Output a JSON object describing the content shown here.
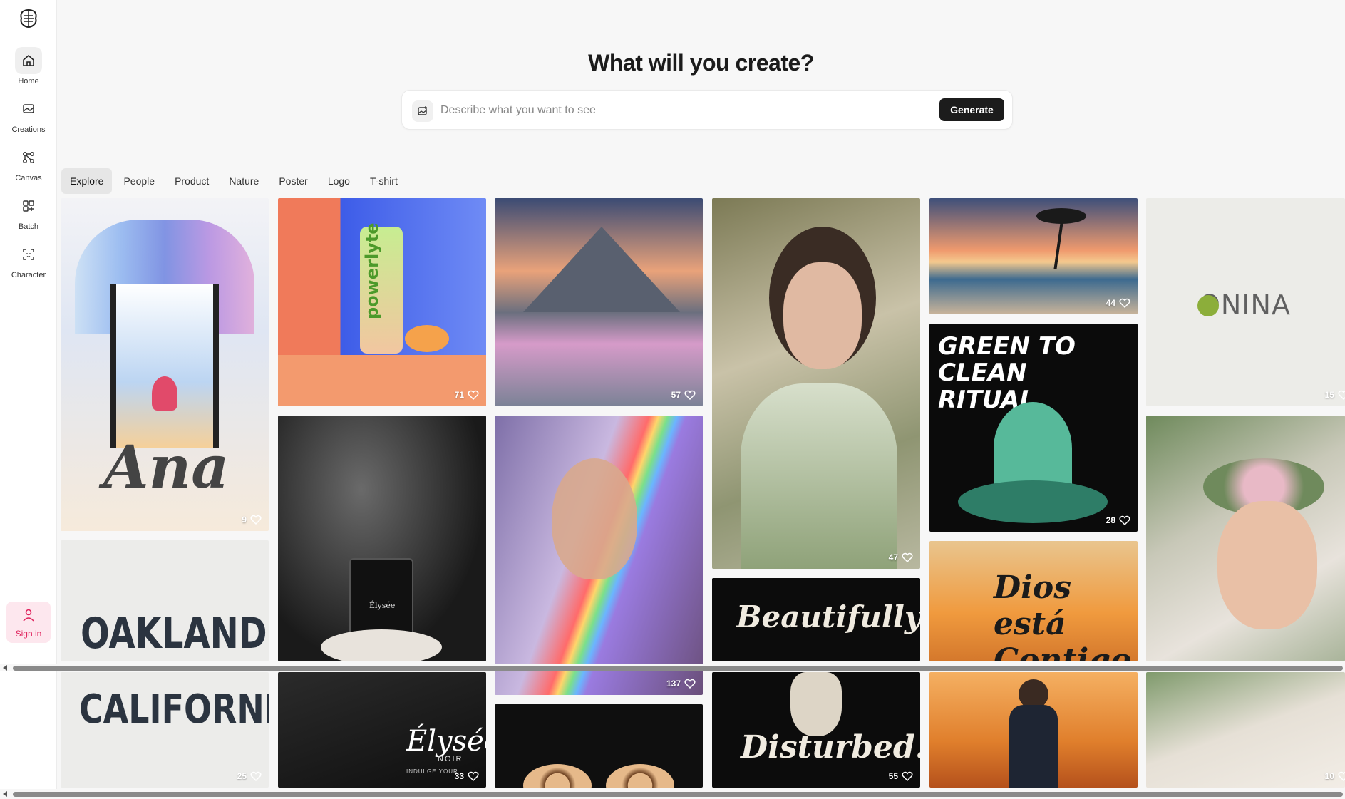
{
  "sidebar": {
    "logo_icon": "brain-logo-icon",
    "items": [
      {
        "label": "Home",
        "icon": "home-icon",
        "active": true
      },
      {
        "label": "Creations",
        "icon": "image-gallery-icon",
        "active": false
      },
      {
        "label": "Canvas",
        "icon": "nodes-icon",
        "active": false
      },
      {
        "label": "Batch",
        "icon": "batch-grid-icon",
        "active": false
      },
      {
        "label": "Character",
        "icon": "face-scan-icon",
        "active": false
      }
    ],
    "signin_label": "Sign in"
  },
  "hero": {
    "title": "What will you create?",
    "search_placeholder": "Describe what you want to see",
    "generate_label": "Generate"
  },
  "tabs": [
    "Explore",
    "People",
    "Product",
    "Nature",
    "Poster",
    "Logo",
    "T-shirt"
  ],
  "active_tab": "Explore",
  "gallery": {
    "tiles": [
      {
        "id": "ana",
        "likes": "9",
        "caption": "Ana"
      },
      {
        "id": "powerlyte",
        "likes": "71",
        "caption": "powerlyte"
      },
      {
        "id": "mountain",
        "likes": "57",
        "caption": ""
      },
      {
        "id": "woman-flowers",
        "likes": "47",
        "caption": ""
      },
      {
        "id": "beach",
        "likes": "44",
        "caption": ""
      },
      {
        "id": "onina",
        "likes": "15",
        "caption": "ONINA"
      },
      {
        "id": "green-clean",
        "likes": "28",
        "caption": "GREEN TO CLEAN RITUAL"
      },
      {
        "id": "perfume",
        "likes": "",
        "caption": "Élysée"
      },
      {
        "id": "rainbow-woman",
        "likes": "137",
        "caption": ""
      },
      {
        "id": "beautifully",
        "likes": "",
        "caption": "Beautifully"
      },
      {
        "id": "dios",
        "likes": "",
        "caption": "Dios está Contigo"
      },
      {
        "id": "girl-flowers",
        "likes": "",
        "caption": ""
      },
      {
        "id": "oakland",
        "likes": "",
        "caption": "OAKLAND"
      },
      {
        "id": "california",
        "likes": "25",
        "caption": "CALIFORNIA"
      },
      {
        "id": "elysee-noir",
        "likes": "33",
        "caption": "Élysée",
        "sub": "NOIR",
        "tag": "INDULGE YOUR"
      },
      {
        "id": "leopard",
        "likes": "",
        "caption": ""
      },
      {
        "id": "disturbed",
        "likes": "55",
        "caption": "Disturbed."
      },
      {
        "id": "forest-woman",
        "likes": "",
        "caption": ""
      },
      {
        "id": "bride",
        "likes": "10",
        "caption": ""
      }
    ]
  },
  "colors": {
    "accent": "#1c1c1c",
    "signin": "#e0245e"
  }
}
